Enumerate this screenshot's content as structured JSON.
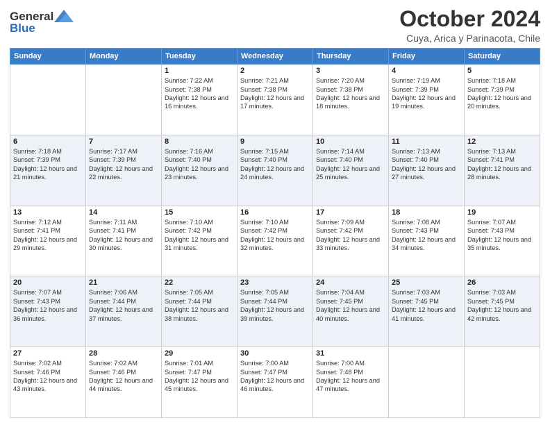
{
  "header": {
    "logo_general": "General",
    "logo_blue": "Blue",
    "month_title": "October 2024",
    "location": "Cuya, Arica y Parinacota, Chile"
  },
  "days_of_week": [
    "Sunday",
    "Monday",
    "Tuesday",
    "Wednesday",
    "Thursday",
    "Friday",
    "Saturday"
  ],
  "weeks": [
    [
      {
        "day": "",
        "sunrise": "",
        "sunset": "",
        "daylight": ""
      },
      {
        "day": "",
        "sunrise": "",
        "sunset": "",
        "daylight": ""
      },
      {
        "day": "1",
        "sunrise": "Sunrise: 7:22 AM",
        "sunset": "Sunset: 7:38 PM",
        "daylight": "Daylight: 12 hours and 16 minutes."
      },
      {
        "day": "2",
        "sunrise": "Sunrise: 7:21 AM",
        "sunset": "Sunset: 7:38 PM",
        "daylight": "Daylight: 12 hours and 17 minutes."
      },
      {
        "day": "3",
        "sunrise": "Sunrise: 7:20 AM",
        "sunset": "Sunset: 7:38 PM",
        "daylight": "Daylight: 12 hours and 18 minutes."
      },
      {
        "day": "4",
        "sunrise": "Sunrise: 7:19 AM",
        "sunset": "Sunset: 7:39 PM",
        "daylight": "Daylight: 12 hours and 19 minutes."
      },
      {
        "day": "5",
        "sunrise": "Sunrise: 7:18 AM",
        "sunset": "Sunset: 7:39 PM",
        "daylight": "Daylight: 12 hours and 20 minutes."
      }
    ],
    [
      {
        "day": "6",
        "sunrise": "Sunrise: 7:18 AM",
        "sunset": "Sunset: 7:39 PM",
        "daylight": "Daylight: 12 hours and 21 minutes."
      },
      {
        "day": "7",
        "sunrise": "Sunrise: 7:17 AM",
        "sunset": "Sunset: 7:39 PM",
        "daylight": "Daylight: 12 hours and 22 minutes."
      },
      {
        "day": "8",
        "sunrise": "Sunrise: 7:16 AM",
        "sunset": "Sunset: 7:40 PM",
        "daylight": "Daylight: 12 hours and 23 minutes."
      },
      {
        "day": "9",
        "sunrise": "Sunrise: 7:15 AM",
        "sunset": "Sunset: 7:40 PM",
        "daylight": "Daylight: 12 hours and 24 minutes."
      },
      {
        "day": "10",
        "sunrise": "Sunrise: 7:14 AM",
        "sunset": "Sunset: 7:40 PM",
        "daylight": "Daylight: 12 hours and 25 minutes."
      },
      {
        "day": "11",
        "sunrise": "Sunrise: 7:13 AM",
        "sunset": "Sunset: 7:40 PM",
        "daylight": "Daylight: 12 hours and 27 minutes."
      },
      {
        "day": "12",
        "sunrise": "Sunrise: 7:13 AM",
        "sunset": "Sunset: 7:41 PM",
        "daylight": "Daylight: 12 hours and 28 minutes."
      }
    ],
    [
      {
        "day": "13",
        "sunrise": "Sunrise: 7:12 AM",
        "sunset": "Sunset: 7:41 PM",
        "daylight": "Daylight: 12 hours and 29 minutes."
      },
      {
        "day": "14",
        "sunrise": "Sunrise: 7:11 AM",
        "sunset": "Sunset: 7:41 PM",
        "daylight": "Daylight: 12 hours and 30 minutes."
      },
      {
        "day": "15",
        "sunrise": "Sunrise: 7:10 AM",
        "sunset": "Sunset: 7:42 PM",
        "daylight": "Daylight: 12 hours and 31 minutes."
      },
      {
        "day": "16",
        "sunrise": "Sunrise: 7:10 AM",
        "sunset": "Sunset: 7:42 PM",
        "daylight": "Daylight: 12 hours and 32 minutes."
      },
      {
        "day": "17",
        "sunrise": "Sunrise: 7:09 AM",
        "sunset": "Sunset: 7:42 PM",
        "daylight": "Daylight: 12 hours and 33 minutes."
      },
      {
        "day": "18",
        "sunrise": "Sunrise: 7:08 AM",
        "sunset": "Sunset: 7:43 PM",
        "daylight": "Daylight: 12 hours and 34 minutes."
      },
      {
        "day": "19",
        "sunrise": "Sunrise: 7:07 AM",
        "sunset": "Sunset: 7:43 PM",
        "daylight": "Daylight: 12 hours and 35 minutes."
      }
    ],
    [
      {
        "day": "20",
        "sunrise": "Sunrise: 7:07 AM",
        "sunset": "Sunset: 7:43 PM",
        "daylight": "Daylight: 12 hours and 36 minutes."
      },
      {
        "day": "21",
        "sunrise": "Sunrise: 7:06 AM",
        "sunset": "Sunset: 7:44 PM",
        "daylight": "Daylight: 12 hours and 37 minutes."
      },
      {
        "day": "22",
        "sunrise": "Sunrise: 7:05 AM",
        "sunset": "Sunset: 7:44 PM",
        "daylight": "Daylight: 12 hours and 38 minutes."
      },
      {
        "day": "23",
        "sunrise": "Sunrise: 7:05 AM",
        "sunset": "Sunset: 7:44 PM",
        "daylight": "Daylight: 12 hours and 39 minutes."
      },
      {
        "day": "24",
        "sunrise": "Sunrise: 7:04 AM",
        "sunset": "Sunset: 7:45 PM",
        "daylight": "Daylight: 12 hours and 40 minutes."
      },
      {
        "day": "25",
        "sunrise": "Sunrise: 7:03 AM",
        "sunset": "Sunset: 7:45 PM",
        "daylight": "Daylight: 12 hours and 41 minutes."
      },
      {
        "day": "26",
        "sunrise": "Sunrise: 7:03 AM",
        "sunset": "Sunset: 7:45 PM",
        "daylight": "Daylight: 12 hours and 42 minutes."
      }
    ],
    [
      {
        "day": "27",
        "sunrise": "Sunrise: 7:02 AM",
        "sunset": "Sunset: 7:46 PM",
        "daylight": "Daylight: 12 hours and 43 minutes."
      },
      {
        "day": "28",
        "sunrise": "Sunrise: 7:02 AM",
        "sunset": "Sunset: 7:46 PM",
        "daylight": "Daylight: 12 hours and 44 minutes."
      },
      {
        "day": "29",
        "sunrise": "Sunrise: 7:01 AM",
        "sunset": "Sunset: 7:47 PM",
        "daylight": "Daylight: 12 hours and 45 minutes."
      },
      {
        "day": "30",
        "sunrise": "Sunrise: 7:00 AM",
        "sunset": "Sunset: 7:47 PM",
        "daylight": "Daylight: 12 hours and 46 minutes."
      },
      {
        "day": "31",
        "sunrise": "Sunrise: 7:00 AM",
        "sunset": "Sunset: 7:48 PM",
        "daylight": "Daylight: 12 hours and 47 minutes."
      },
      {
        "day": "",
        "sunrise": "",
        "sunset": "",
        "daylight": ""
      },
      {
        "day": "",
        "sunrise": "",
        "sunset": "",
        "daylight": ""
      }
    ]
  ]
}
